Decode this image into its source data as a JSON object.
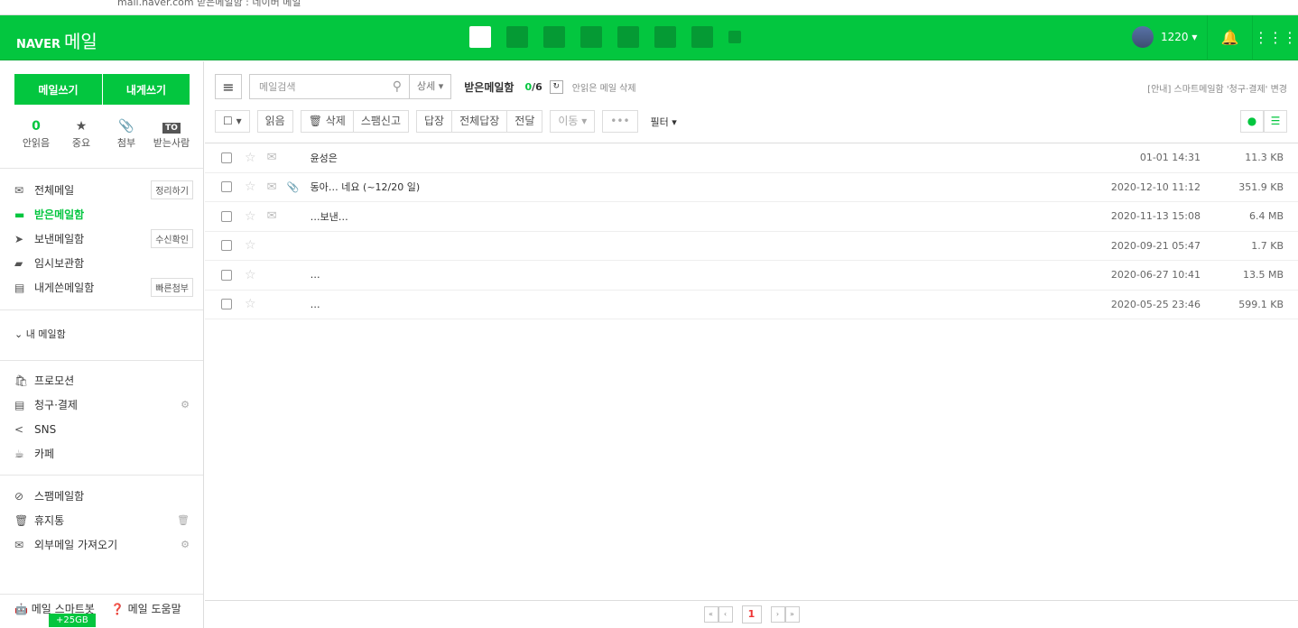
{
  "browser": {
    "url": "mail.naver.com",
    "title": "받은메일함 : 네이버 메일"
  },
  "header": {
    "brand": "NAVER",
    "product": "메일",
    "user": "1220 ▾",
    "bell": "🔔",
    "apps": "⋮⋮⋮"
  },
  "sidebar": {
    "write": "메일쓰기",
    "write_self": "내게쓰기",
    "quick": [
      {
        "icon": "0",
        "label": "안읽음"
      },
      {
        "icon": "★",
        "label": "중요"
      },
      {
        "icon": "📎",
        "label": "첨부"
      },
      {
        "icon": "TO",
        "label": "받는사람"
      }
    ],
    "folders": [
      {
        "icon": "✉",
        "label": "전체메일",
        "tag": "정리하기"
      },
      {
        "icon": "▬",
        "label": "받은메일함",
        "tag": ""
      },
      {
        "icon": "➤",
        "label": "보낸메일함",
        "tag": "수신확인"
      },
      {
        "icon": "▰",
        "label": "임시보관함",
        "tag": ""
      },
      {
        "icon": "▤",
        "label": "내게쓴메일함",
        "tag": "빠른첨부"
      }
    ],
    "my_mailbox": "⌄  내 메일함",
    "smart": [
      {
        "icon": "🛍",
        "label": "프로모션"
      },
      {
        "icon": "▤",
        "label": "청구·결제",
        "gear": "⚙"
      },
      {
        "icon": "<",
        "label": "SNS"
      },
      {
        "icon": "☕",
        "label": "카페"
      }
    ],
    "etc": [
      {
        "icon": "⊘",
        "label": "스팸메일함"
      },
      {
        "icon": "🗑",
        "label": "휴지통",
        "gear": "🗑"
      },
      {
        "icon": "✉",
        "label": "외부메일 가져오기",
        "gear": "⚙"
      }
    ],
    "smartbot": "메일 스마트봇",
    "help": "메일 도움말",
    "storage": "+25GB"
  },
  "toolbar": {
    "search_placeholder": "메일검색",
    "detail": "상세 ▾",
    "box": "받은메일함",
    "unread": "0",
    "total": "/6",
    "delete_unread": "안읽은 메일 삭제",
    "notice": "[안내] 스마트메일함 '청구·결제' 변경",
    "read": "읽음",
    "delete": "🗑 삭제",
    "spam": "스팸신고",
    "reply": "답장",
    "reply_all": "전체답장",
    "forward": "전달",
    "move": "이동 ▾",
    "more": "•••",
    "filter": "필터 ▾"
  },
  "emails": [
    {
      "subject": "윤성은",
      "date": "01-01 14:31",
      "size": "11.3 KB",
      "attach": false
    },
    {
      "subject": "동아… 네요 (~12/20 일)",
      "date": "2020-12-10 11:12",
      "size": "351.9 KB",
      "attach": true
    },
    {
      "subject": "…보낸…",
      "date": "2020-11-13 15:08",
      "size": "6.4 MB",
      "attach": false
    },
    {
      "subject": "",
      "date": "2020-09-21 05:47",
      "size": "1.7 KB",
      "attach": false
    },
    {
      "subject": "…",
      "date": "2020-06-27 10:41",
      "size": "13.5 MB",
      "attach": false
    },
    {
      "subject": "…",
      "date": "2020-05-25 23:46",
      "size": "599.1 KB",
      "attach": false
    }
  ],
  "pager": {
    "current": "1"
  }
}
